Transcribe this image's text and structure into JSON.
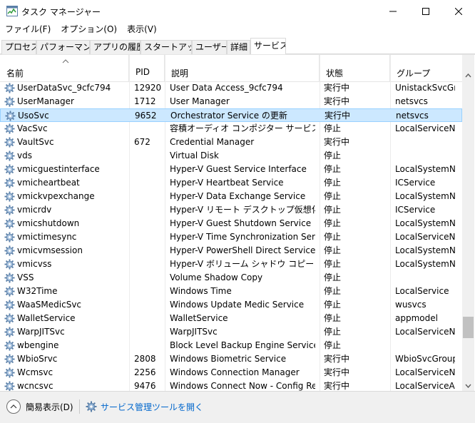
{
  "window": {
    "title": "タスク マネージャー"
  },
  "menu": [
    "ファイル(F)",
    "オプション(O)",
    "表示(V)"
  ],
  "tabs": [
    "プロセス",
    "パフォーマンス",
    "アプリの履歴",
    "スタートアップ",
    "ユーザー",
    "詳細",
    "サービス"
  ],
  "active_tab": "サービス",
  "columns": {
    "name": "名前",
    "pid": "PID",
    "description": "説明",
    "status": "状態",
    "group": "グループ"
  },
  "services": [
    {
      "name": "UserDataSvc_9cfc794",
      "pid": "12920",
      "description": "User Data Access_9cfc794",
      "status": "実行中",
      "group": "UnistackSvcGr..."
    },
    {
      "name": "UserManager",
      "pid": "1712",
      "description": "User Manager",
      "status": "実行中",
      "group": "netsvcs"
    },
    {
      "name": "UsoSvc",
      "pid": "9652",
      "description": "Orchestrator Service の更新",
      "status": "実行中",
      "group": "netsvcs",
      "selected": true
    },
    {
      "name": "VacSvc",
      "pid": "",
      "description": "容積オーディオ コンポジター サービス",
      "status": "停止",
      "group": "LocalServiceN..."
    },
    {
      "name": "VaultSvc",
      "pid": "672",
      "description": "Credential Manager",
      "status": "実行中",
      "group": ""
    },
    {
      "name": "vds",
      "pid": "",
      "description": "Virtual Disk",
      "status": "停止",
      "group": ""
    },
    {
      "name": "vmicguestinterface",
      "pid": "",
      "description": "Hyper-V Guest Service Interface",
      "status": "停止",
      "group": "LocalSystemN..."
    },
    {
      "name": "vmicheartbeat",
      "pid": "",
      "description": "Hyper-V Heartbeat Service",
      "status": "停止",
      "group": "ICService"
    },
    {
      "name": "vmickvpexchange",
      "pid": "",
      "description": "Hyper-V Data Exchange Service",
      "status": "停止",
      "group": "LocalSystemN..."
    },
    {
      "name": "vmicrdv",
      "pid": "",
      "description": "Hyper-V リモート デスクトップ仮想化サー...",
      "status": "停止",
      "group": "ICService"
    },
    {
      "name": "vmicshutdown",
      "pid": "",
      "description": "Hyper-V Guest Shutdown Service",
      "status": "停止",
      "group": "LocalSystemN..."
    },
    {
      "name": "vmictimesync",
      "pid": "",
      "description": "Hyper-V Time Synchronization Service",
      "status": "停止",
      "group": "LocalServiceN..."
    },
    {
      "name": "vmicvmsession",
      "pid": "",
      "description": "Hyper-V PowerShell Direct Service",
      "status": "停止",
      "group": "LocalSystemN..."
    },
    {
      "name": "vmicvss",
      "pid": "",
      "description": "Hyper-V ボリューム シャドウ コピー リクエス...",
      "status": "停止",
      "group": "LocalSystemN..."
    },
    {
      "name": "VSS",
      "pid": "",
      "description": "Volume Shadow Copy",
      "status": "停止",
      "group": ""
    },
    {
      "name": "W32Time",
      "pid": "",
      "description": "Windows Time",
      "status": "停止",
      "group": "LocalService"
    },
    {
      "name": "WaaSMedicSvc",
      "pid": "",
      "description": "Windows Update Medic Service",
      "status": "停止",
      "group": "wusvcs"
    },
    {
      "name": "WalletService",
      "pid": "",
      "description": "WalletService",
      "status": "停止",
      "group": "appmodel"
    },
    {
      "name": "WarpJITSvc",
      "pid": "",
      "description": "WarpJITSvc",
      "status": "停止",
      "group": "LocalServiceN..."
    },
    {
      "name": "wbengine",
      "pid": "",
      "description": "Block Level Backup Engine Service",
      "status": "停止",
      "group": ""
    },
    {
      "name": "WbioSrvc",
      "pid": "2808",
      "description": "Windows Biometric Service",
      "status": "実行中",
      "group": "WbioSvcGroup"
    },
    {
      "name": "Wcmsvc",
      "pid": "2256",
      "description": "Windows Connection Manager",
      "status": "実行中",
      "group": "LocalServiceN..."
    },
    {
      "name": "wcncsvc",
      "pid": "9476",
      "description": "Windows Connect Now - Config Reg...",
      "status": "実行中",
      "group": "LocalServiceA..."
    }
  ],
  "footer": {
    "fewer_details": "簡易表示(D)",
    "open_services": "サービス管理ツールを開く"
  },
  "colors": {
    "selected_row": "#cce8ff",
    "link": "#0066cc",
    "icon_gear": "#5a7fa8"
  }
}
